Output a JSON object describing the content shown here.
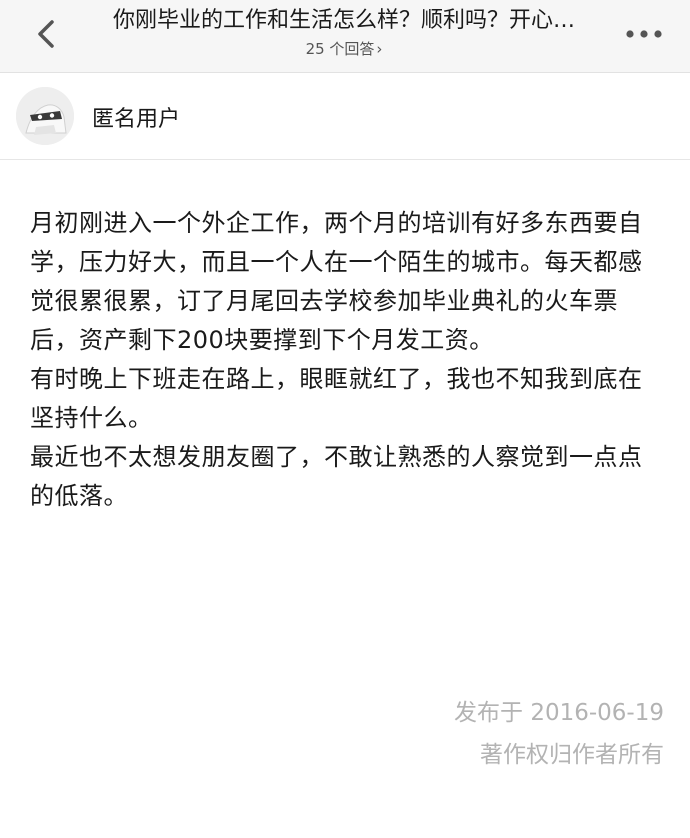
{
  "header": {
    "question_title": "你刚毕业的工作和生活怎么样？顺利吗？开心…",
    "answers_count": "25 个回答",
    "answers_chevron": "›"
  },
  "author": {
    "name": "匿名用户"
  },
  "answer": {
    "paragraphs": [
      "月初刚进入一个外企工作，两个月的培训有好多东西要自学，压力好大，而且一个人在一个陌生的城市。每天都感觉很累很累，订了月尾回去学校参加毕业典礼的火车票后，资产剩下200块要撑到下个月发工资。",
      "有时晚上下班走在路上，眼眶就红了，我也不知我到底在坚持什么。",
      "最近也不太想发朋友圈了，不敢让熟悉的人察觉到一点点的低落。"
    ]
  },
  "footer": {
    "published": "发布于 2016-06-19",
    "copyright": "著作权归作者所有"
  },
  "icons": {
    "back": "chevron-left-icon",
    "more": "more-dots-icon",
    "avatar": "anonymous-avatar-icon"
  }
}
